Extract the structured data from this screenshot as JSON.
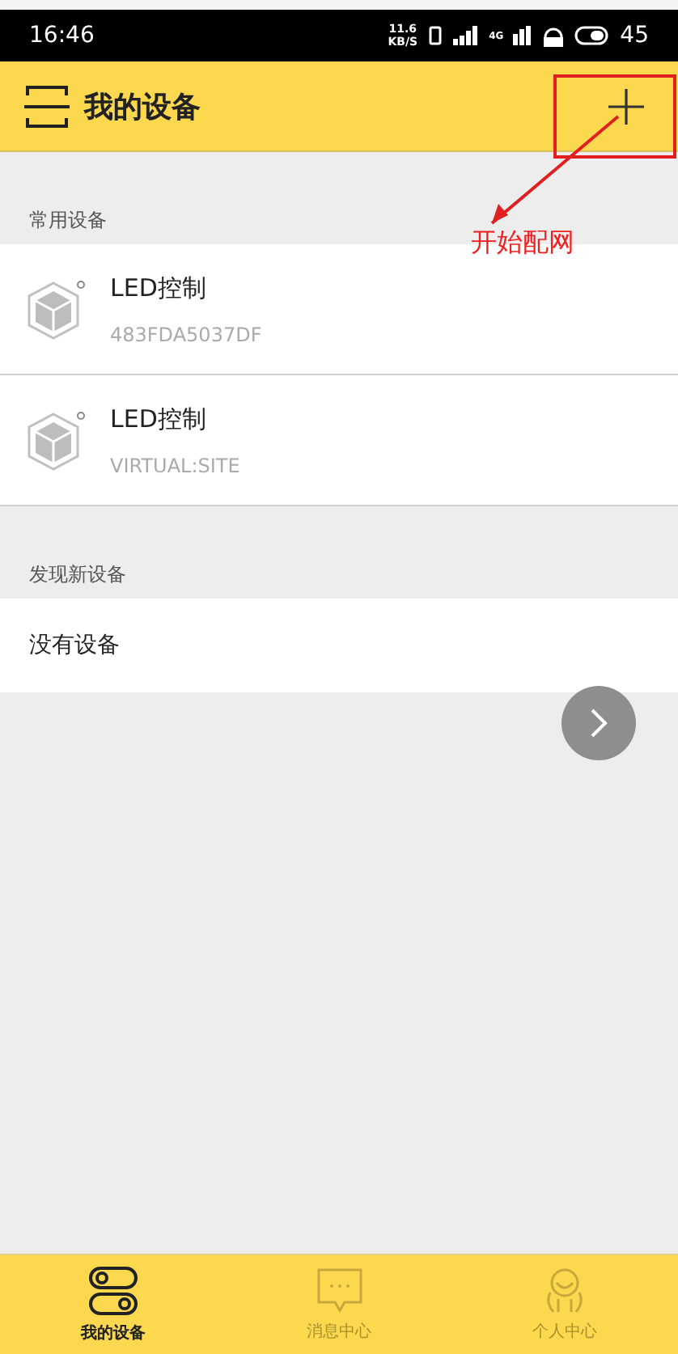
{
  "status_bar": {
    "time": "16:46",
    "speed": "11.6",
    "speed_unit": "KB/S",
    "net": "4G",
    "battery": "45"
  },
  "header": {
    "title": "我的设备"
  },
  "annotation": {
    "text": "开始配网"
  },
  "sections": [
    {
      "title": "常用设备",
      "devices": [
        {
          "name": "LED控制",
          "id": "483FDA5037DF"
        },
        {
          "name": "LED控制",
          "id": "VIRTUAL:SITE"
        }
      ]
    },
    {
      "title": "发现新设备",
      "empty": "没有设备"
    }
  ],
  "tabs": [
    {
      "label": "我的设备",
      "selected": true,
      "kind": "devices"
    },
    {
      "label": "消息中心",
      "selected": false,
      "kind": "messages"
    },
    {
      "label": "个人中心",
      "selected": false,
      "kind": "profile"
    }
  ]
}
